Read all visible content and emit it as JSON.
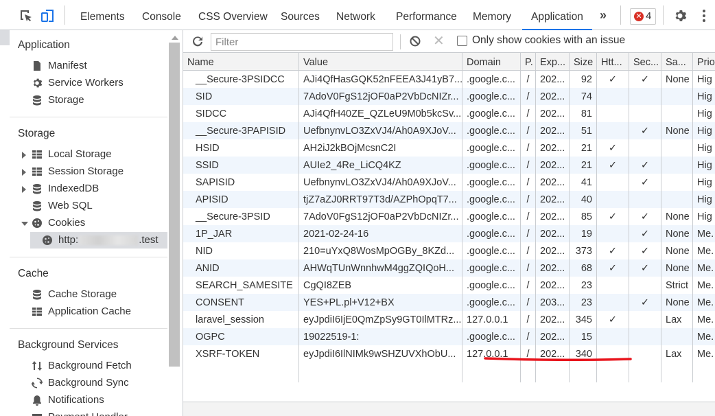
{
  "topbar": {
    "tabs": [
      {
        "label": "Elements"
      },
      {
        "label": "Console"
      },
      {
        "label": "CSS Overview"
      },
      {
        "label": "Sources"
      },
      {
        "label": "Network"
      },
      {
        "label": "Performance"
      },
      {
        "label": "Memory"
      },
      {
        "label": "Application"
      }
    ],
    "active_tab": "Application",
    "error_count": "4",
    "more_label": "»"
  },
  "sidebar": {
    "application": {
      "title": "Application",
      "items": [
        {
          "label": "Manifest",
          "icon": "document-icon"
        },
        {
          "label": "Service Workers",
          "icon": "gear-icon"
        },
        {
          "label": "Storage",
          "icon": "database-icon"
        }
      ]
    },
    "storage": {
      "title": "Storage",
      "items": [
        {
          "label": "Local Storage",
          "icon": "grid-icon"
        },
        {
          "label": "Session Storage",
          "icon": "grid-icon"
        },
        {
          "label": "IndexedDB",
          "icon": "database-icon"
        },
        {
          "label": "Web SQL",
          "icon": "database-icon"
        },
        {
          "label": "Cookies",
          "icon": "cookie-icon"
        }
      ],
      "cookie_origin_prefix": "http:",
      "cookie_origin_suffix": ".test"
    },
    "cache": {
      "title": "Cache",
      "items": [
        {
          "label": "Cache Storage",
          "icon": "database-icon"
        },
        {
          "label": "Application Cache",
          "icon": "grid-icon"
        }
      ]
    },
    "background": {
      "title": "Background Services",
      "items": [
        {
          "label": "Background Fetch",
          "icon": "arrows-updown-icon"
        },
        {
          "label": "Background Sync",
          "icon": "sync-icon"
        },
        {
          "label": "Notifications",
          "icon": "bell-icon"
        },
        {
          "label": "Payment Handler",
          "icon": "card-icon"
        }
      ]
    }
  },
  "toolbar": {
    "filter_placeholder": "Filter",
    "only_issues_label": "Only show cookies with an issue"
  },
  "table": {
    "columns": [
      "Name",
      "Value",
      "Domain",
      "P.",
      "Exp...",
      "Size",
      "Htt...",
      "Sec...",
      "Sa...",
      "Prio"
    ],
    "rows": [
      [
        "__Secure-3PSIDCC",
        "AJi4QfHasGQK52nFEEA3J41yB7...",
        ".google.c...",
        "/",
        "202...",
        "92",
        "✓",
        "✓",
        "None",
        "Hig"
      ],
      [
        "SID",
        "7AdoV0FgS12jOF0aP2VbDcNIZr...",
        ".google.c...",
        "/",
        "202...",
        "74",
        "",
        "",
        "",
        "Hig"
      ],
      [
        "SIDCC",
        "AJi4QfH40ZE_QZLeU9M0b5kcSv...",
        ".google.c...",
        "/",
        "202...",
        "81",
        "",
        "",
        "",
        "Hig"
      ],
      [
        "__Secure-3PAPISID",
        "UefbnynvLO3ZxVJ4/Ah0A9XJoV...",
        ".google.c...",
        "/",
        "202...",
        "51",
        "",
        "✓",
        "None",
        "Hig"
      ],
      [
        "HSID",
        "AH2iJ2kBOjMcsnC2I",
        ".google.c...",
        "/",
        "202...",
        "21",
        "✓",
        "",
        "",
        "Hig"
      ],
      [
        "SSID",
        "AUIe2_4Re_LiCQ4KZ",
        ".google.c...",
        "/",
        "202...",
        "21",
        "✓",
        "✓",
        "",
        "Hig"
      ],
      [
        "SAPISID",
        "UefbnynvLO3ZxVJ4/Ah0A9XJoV...",
        ".google.c...",
        "/",
        "202...",
        "41",
        "",
        "✓",
        "",
        "Hig"
      ],
      [
        "APISID",
        "tjZ7aZJ0RRT97T3d/AZPhOpqT7...",
        ".google.c...",
        "/",
        "202...",
        "40",
        "",
        "",
        "",
        "Hig"
      ],
      [
        "__Secure-3PSID",
        "7AdoV0FgS12jOF0aP2VbDcNIZr...",
        ".google.c...",
        "/",
        "202...",
        "85",
        "✓",
        "✓",
        "None",
        "Hig"
      ],
      [
        "1P_JAR",
        "2021-02-24-16",
        ".google.c...",
        "/",
        "202...",
        "19",
        "",
        "✓",
        "None",
        "Me."
      ],
      [
        "NID",
        "210=uYxQ8WosMpOGBy_8KZd...",
        ".google.c...",
        "/",
        "202...",
        "373",
        "✓",
        "✓",
        "None",
        "Me."
      ],
      [
        "ANID",
        "AHWqTUnWnnhwM4ggZQIQoH...",
        ".google.c...",
        "/",
        "202...",
        "68",
        "✓",
        "✓",
        "None",
        "Me."
      ],
      [
        "SEARCH_SAMESITE",
        "CgQI8ZEB",
        ".google.c...",
        "/",
        "202...",
        "23",
        "",
        "",
        "Strict",
        "Me."
      ],
      [
        "CONSENT",
        "YES+PL.pl+V12+BX",
        ".google.c...",
        "/",
        "203...",
        "23",
        "",
        "✓",
        "None",
        "Me."
      ],
      [
        "laravel_session",
        "eyJpdiI6IjE0QmZpSy9GT0IlMTRz...",
        "127.0.0.1",
        "/",
        "202...",
        "345",
        "✓",
        "",
        "Lax",
        "Me."
      ],
      [
        "OGPC",
        "19022519-1:",
        ".google.c...",
        "/",
        "202...",
        "15",
        "",
        "",
        "",
        "Me."
      ],
      [
        "XSRF-TOKEN",
        "eyJpdiI6IlNIMk9wSHZUVXhObU...",
        "127.0.0.1",
        "/",
        "202...",
        "340",
        "",
        "",
        "Lax",
        "Me."
      ]
    ]
  },
  "colors": {
    "accent": "#1a73e8",
    "error": "#d93025",
    "row_alt": "#f0f6fd",
    "annotation": "#e8141c"
  }
}
